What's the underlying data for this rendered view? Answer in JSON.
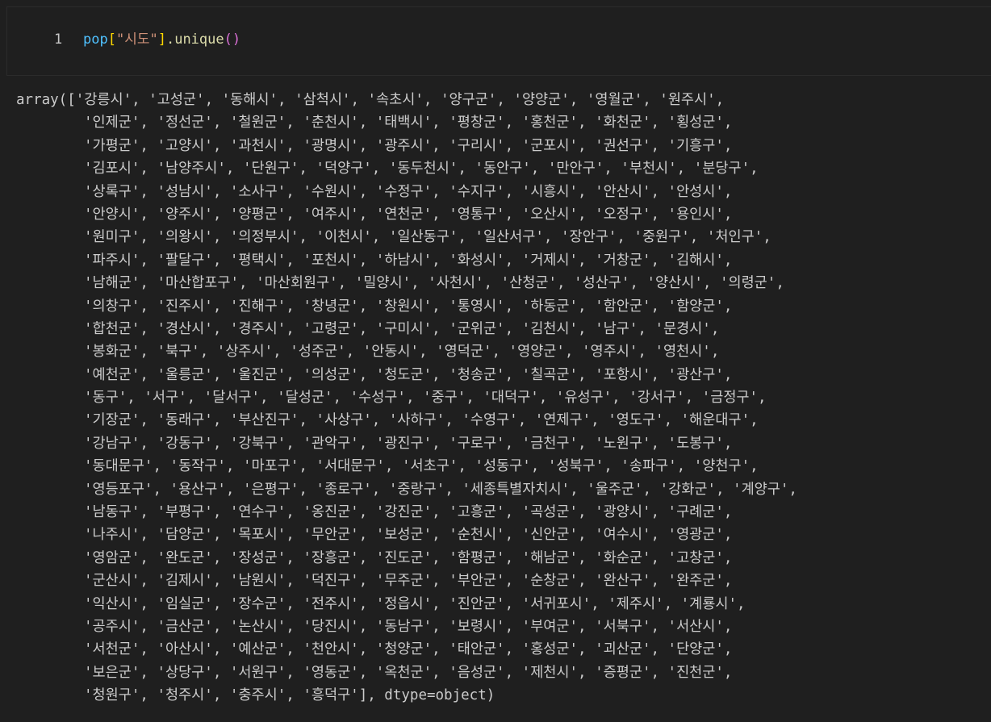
{
  "input_cell": {
    "line_number": "1",
    "code": {
      "var": "pop",
      "open_bracket": "[",
      "string": "\"시도\"",
      "close_bracket": "]",
      "method": ".unique",
      "open_paren": "(",
      "close_paren": ")"
    }
  },
  "output_cell": {
    "lines": [
      "array(['강릉시', '고성군', '동해시', '삼척시', '속초시', '양구군', '양양군', '영월군', '원주시',",
      "'인제군', '정선군', '철원군', '춘천시', '태백시', '평창군', '홍천군', '화천군', '횡성군',",
      "'가평군', '고양시', '과천시', '광명시', '광주시', '구리시', '군포시', '권선구', '기흥구',",
      "'김포시', '남양주시', '단원구', '덕양구', '동두천시', '동안구', '만안구', '부천시', '분당구',",
      "'상록구', '성남시', '소사구', '수원시', '수정구', '수지구', '시흥시', '안산시', '안성시',",
      "'안양시', '양주시', '양평군', '여주시', '연천군', '영통구', '오산시', '오정구', '용인시',",
      "'원미구', '의왕시', '의정부시', '이천시', '일산동구', '일산서구', '장안구', '중원구', '처인구',",
      "'파주시', '팔달구', '평택시', '포천시', '하남시', '화성시', '거제시', '거창군', '김해시',",
      "'남해군', '마산합포구', '마산회원구', '밀양시', '사천시', '산청군', '성산구', '양산시', '의령군',",
      "'의창구', '진주시', '진해구', '창녕군', '창원시', '통영시', '하동군', '함안군', '함양군',",
      "'합천군', '경산시', '경주시', '고령군', '구미시', '군위군', '김천시', '남구', '문경시',",
      "'봉화군', '북구', '상주시', '성주군', '안동시', '영덕군', '영양군', '영주시', '영천시',",
      "'예천군', '울릉군', '울진군', '의성군', '청도군', '청송군', '칠곡군', '포항시', '광산구',",
      "'동구', '서구', '달서구', '달성군', '수성구', '중구', '대덕구', '유성구', '강서구', '금정구',",
      "'기장군', '동래구', '부산진구', '사상구', '사하구', '수영구', '연제구', '영도구', '해운대구',",
      "'강남구', '강동구', '강북구', '관악구', '광진구', '구로구', '금천구', '노원구', '도봉구',",
      "'동대문구', '동작구', '마포구', '서대문구', '서초구', '성동구', '성북구', '송파구', '양천구',",
      "'영등포구', '용산구', '은평구', '종로구', '중랑구', '세종특별자치시', '울주군', '강화군', '계양구',",
      "'남동구', '부평구', '연수구', '옹진군', '강진군', '고흥군', '곡성군', '광양시', '구례군',",
      "'나주시', '담양군', '목포시', '무안군', '보성군', '순천시', '신안군', '여수시', '영광군',",
      "'영암군', '완도군', '장성군', '장흥군', '진도군', '함평군', '해남군', '화순군', '고창군',",
      "'군산시', '김제시', '남원시', '덕진구', '무주군', '부안군', '순창군', '완산구', '완주군',",
      "'익산시', '임실군', '장수군', '전주시', '정읍시', '진안군', '서귀포시', '제주시', '계룡시',",
      "'공주시', '금산군', '논산시', '당진시', '동남구', '보령시', '부여군', '서북구', '서산시',",
      "'서천군', '아산시', '예산군', '천안시', '청양군', '태안군', '홍성군', '괴산군', '단양군',",
      "'보은군', '상당구', '서원구', '영동군', '옥천군', '음성군', '제천시', '증평군', '진천군',",
      "'청원구', '청주시', '충주시', '흥덕구'], dtype=object)"
    ]
  }
}
